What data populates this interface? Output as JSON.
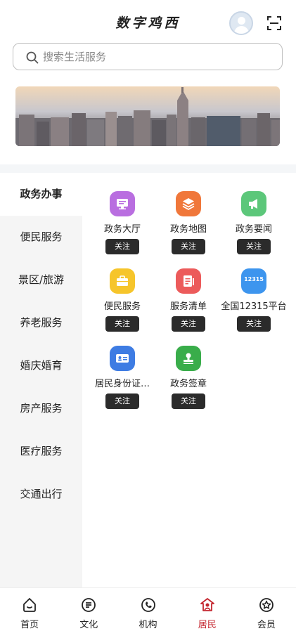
{
  "header": {
    "title": "数字鸡西"
  },
  "search": {
    "placeholder": "搜索生活服务"
  },
  "categories": [
    {
      "label": "政务办事",
      "active": true
    },
    {
      "label": "便民服务"
    },
    {
      "label": "景区/旅游"
    },
    {
      "label": "养老服务"
    },
    {
      "label": "婚庆婚育"
    },
    {
      "label": "房产服务"
    },
    {
      "label": "医疗服务"
    },
    {
      "label": "交通出行"
    }
  ],
  "services": [
    {
      "label": "政务大厅",
      "button": "关注",
      "icon": "monitor-icon",
      "color": "#b96ee0"
    },
    {
      "label": "政务地图",
      "button": "关注",
      "icon": "layers-icon",
      "color": "#f0773a"
    },
    {
      "label": "政务要闻",
      "button": "关注",
      "icon": "megaphone-icon",
      "color": "#5cc77a"
    },
    {
      "label": "便民服务",
      "button": "关注",
      "icon": "briefcase-icon",
      "color": "#f6c52b"
    },
    {
      "label": "服务清单",
      "button": "关注",
      "icon": "document-icon",
      "color": "#ec5b5b"
    },
    {
      "label": "全国12315平台",
      "button": "关注",
      "icon": "badge-12315-icon",
      "icon_text": "12315",
      "color": "#3d95ee"
    },
    {
      "label": "居民身份证…",
      "button": "关注",
      "icon": "id-card-icon",
      "color": "#3e7ce3"
    },
    {
      "label": "政务签章",
      "button": "关注",
      "icon": "stamp-icon",
      "color": "#39ad4a"
    }
  ],
  "bottom_nav": [
    {
      "label": "首页",
      "icon": "home-icon"
    },
    {
      "label": "文化",
      "icon": "culture-icon"
    },
    {
      "label": "机构",
      "icon": "phone-icon"
    },
    {
      "label": "居民",
      "icon": "resident-icon",
      "active": true
    },
    {
      "label": "会员",
      "icon": "member-icon"
    }
  ],
  "colors": {
    "active_nav": "#c4252e",
    "button_bg": "#2b2b2b"
  }
}
